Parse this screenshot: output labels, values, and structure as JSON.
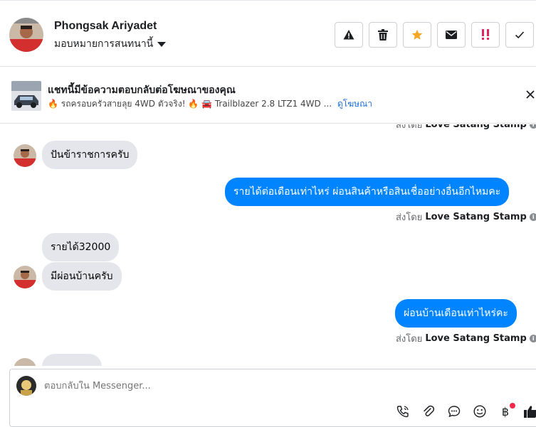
{
  "header": {
    "name": "Phongsak Ariyadet",
    "assign_label": "มอบหมายการสนทนานี้",
    "actions": [
      {
        "name": "report-button",
        "icon": "warning-icon"
      },
      {
        "name": "delete-button",
        "icon": "trash-icon"
      },
      {
        "name": "star-button",
        "icon": "star-icon"
      },
      {
        "name": "mark-unread-button",
        "icon": "envelope-icon"
      },
      {
        "name": "mark-spam-button",
        "icon": "double-exclamation-icon"
      },
      {
        "name": "mark-done-button",
        "icon": "check-icon"
      }
    ]
  },
  "ad": {
    "title": "แชทนี้มีข้อความตอบกลับต่อโฆษณาของคุณ",
    "subtitle_prefix": "🔥 รถครอบครัวสายลุย 4WD ตัวจริง! 🔥 🚘 Trailblazer 2.8 LTZ1 4WD ...",
    "link_label": "ดูโฆษณา"
  },
  "chat": {
    "sent_by_prefix": "ส่งโดย",
    "sender_name": "Love Satang Stamp",
    "messages": [
      {
        "dir": "in",
        "text": "ปันข้าราชการครับ"
      },
      {
        "dir": "out",
        "text": "รายได้ต่อเดือนเท่าไหร่ ผ่อนสินค้าหรือสินเชื่ออย่างอื่นอีกไหมคะ"
      },
      {
        "dir": "in",
        "text": "รายได้32000"
      },
      {
        "dir": "in",
        "text": "มีผ่อนบ้านครับ"
      },
      {
        "dir": "out",
        "text": "ผ่อนบ้านเดือนเท่าไหร่คะ"
      }
    ]
  },
  "composer": {
    "placeholder": "ตอบกลับใน Messenger...",
    "icons": [
      "call-icon",
      "attachment-icon",
      "saved-reply-icon",
      "emoji-icon",
      "baht-payment-icon",
      "thumbs-up-icon"
    ]
  },
  "colors": {
    "accent": "#0084ff",
    "incoming_bubble": "#e4e6eb",
    "star": "#f5a623",
    "spam": "#e0245e",
    "notification_dot": "#f02849"
  }
}
